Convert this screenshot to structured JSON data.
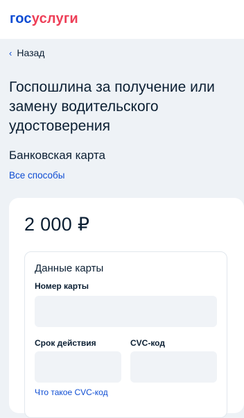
{
  "header": {
    "logo_part1": "гос",
    "logo_part2": "услуги"
  },
  "nav": {
    "back_label": "Назад"
  },
  "page": {
    "title": "Госпошлина за получение или замену водительского удостоверения",
    "payment_method": "Банковская карта",
    "all_methods_link": "Все способы"
  },
  "payment": {
    "amount": "2 000 ₽",
    "card_section_title": "Данные карты",
    "card_number_label": "Номер карты",
    "card_number_value": "",
    "expiry_label": "Срок действия",
    "expiry_value": "",
    "cvc_label": "CVC-код",
    "cvc_value": "",
    "cvc_help_link": "Что такое CVC-код"
  },
  "colors": {
    "brand_blue": "#0d4cd3",
    "brand_red": "#ee3f58",
    "text": "#0b1f33",
    "background": "#eef2f6",
    "field_bg": "#f0f3f7"
  }
}
